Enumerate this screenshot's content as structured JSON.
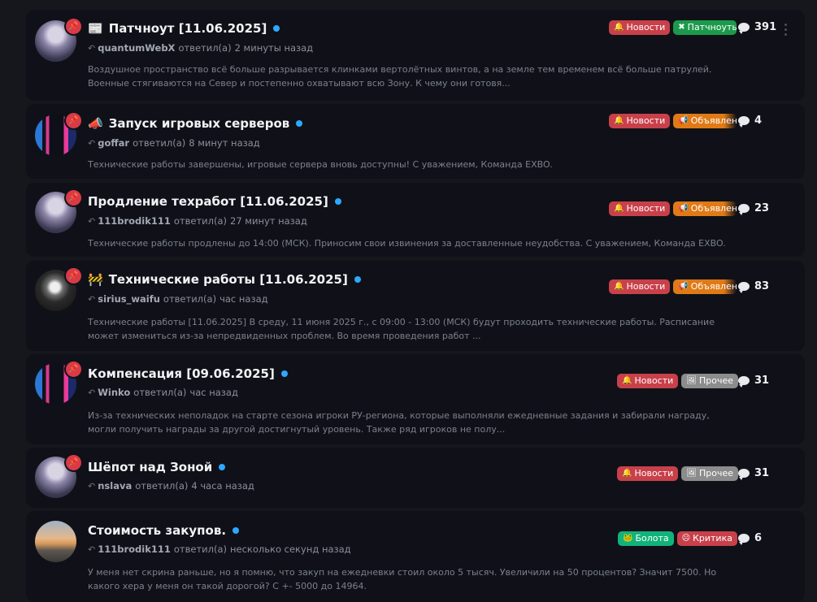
{
  "colors": {
    "news": "#c8404a",
    "patch": "#1c9a4c",
    "announce": "#e07a16",
    "other": "#8c8c8c",
    "swamp": "#12b37a",
    "critic": "#c8404a",
    "unread_dot": "#2ea8ff"
  },
  "topics": [
    {
      "avatar": "anime-girl",
      "pinned": true,
      "emoji": "📰",
      "title": "Патчноут [11.06.2025]",
      "user": "quantumWebX",
      "action": "ответил(а)",
      "time": "2 минуты назад",
      "excerpt": "Воздушное пространство всё больше разрывается клинками вертолётных винтов, а на земле тем временем всё больше патрулей. Военные стягиваются на Север и постепенно охватывают всю Зону. К чему они готовя...",
      "tags": [
        {
          "label": "Новости",
          "icon": "bell-icon"
        },
        {
          "label": "Патчноуты",
          "icon": "wrench-icon"
        }
      ],
      "replies": "391"
    },
    {
      "avatar": "neon-city",
      "pinned": true,
      "emoji": "📣",
      "title": "Запуск игровых серверов",
      "user": "goffar",
      "action": "ответил(а)",
      "time": "8 минут назад",
      "excerpt": "Технические работы завершены, игровые сервера вновь доступны! С уважением, Команда EXBO.",
      "tags": [
        {
          "label": "Новости",
          "icon": "bell-icon"
        },
        {
          "label": "Объявления",
          "icon": "megaphone-icon"
        }
      ],
      "replies": "4"
    },
    {
      "avatar": "anime-girl",
      "pinned": true,
      "emoji": "",
      "title": "Продление техработ [11.06.2025]",
      "user": "111brodik111",
      "action": "ответил(а)",
      "time": "27 минут назад",
      "excerpt": "Технические работы продлены до 14:00 (МСК). Приносим свои извинения за доставленные неудобства. С уважением, Команда EXBO.",
      "tags": [
        {
          "label": "Новости",
          "icon": "bell-icon"
        },
        {
          "label": "Объявления",
          "icon": "megaphone-icon"
        }
      ],
      "replies": "23"
    },
    {
      "avatar": "dark-art",
      "pinned": true,
      "emoji": "🚧",
      "title": "Технические работы [11.06.2025]",
      "user": "sirius_waifu",
      "action": "ответил(а)",
      "time": "час назад",
      "excerpt": "Технические работы [11.06.2025] В среду, 11 июня 2025 г., с 09:00 - 13:00 (МСК) будут проходить технические работы. Расписание может измениться из-за непредвиденных проблем. Во время проведения работ ...",
      "tags": [
        {
          "label": "Новости",
          "icon": "bell-icon"
        },
        {
          "label": "Объявления",
          "icon": "megaphone-icon"
        }
      ],
      "replies": "83"
    },
    {
      "avatar": "neon-city",
      "pinned": true,
      "emoji": "",
      "title": "Компенсация [09.06.2025]",
      "user": "Winko",
      "action": "ответил(а)",
      "time": "час назад",
      "excerpt": "Из-за технических неполадок на старте сезона игроки РУ-региона, которые выполняли ежедневные задания и забирали награду, могли получить награды за другой достигнутый уровень. Также ряд игроков не полу...",
      "tags": [
        {
          "label": "Новости",
          "icon": "bell-icon"
        },
        {
          "label": "Прочее",
          "icon": "image-icon"
        }
      ],
      "replies": "31"
    },
    {
      "avatar": "anime-girl",
      "pinned": true,
      "emoji": "",
      "title": "Шёпот над Зоной",
      "user": "nslava",
      "action": "ответил(а)",
      "time": "4 часа назад",
      "excerpt": "",
      "tags": [
        {
          "label": "Новости",
          "icon": "bell-icon"
        },
        {
          "label": "Прочее",
          "icon": "image-icon"
        }
      ],
      "replies": "31"
    },
    {
      "avatar": "sunset",
      "pinned": false,
      "emoji": "",
      "title": "Стоимость закупов.",
      "user": "111brodik111",
      "action": "ответил(а)",
      "time": "несколько секунд назад",
      "excerpt": "У меня нет скрина раньше, но я помню, что закуп на ежедневки стоил около 5 тысяч. Увеличили на 50 процентов? Значит 7500. Но какого хера у меня он такой дорогой? С +- 5000 до 14964.",
      "tags": [
        {
          "label": "Болота",
          "icon": "frog-icon"
        },
        {
          "label": "Критика",
          "icon": "angry-face-icon"
        }
      ],
      "replies": "6"
    }
  ]
}
